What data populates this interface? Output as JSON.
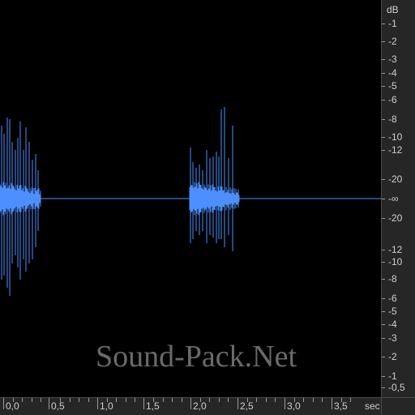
{
  "watermark": "Sound-Pack.Net",
  "db_ruler": {
    "unit": "dB",
    "upper": [
      "-1",
      "-2",
      "-3",
      "-4",
      "-5",
      "-6",
      "-8",
      "-10",
      "-12",
      "-20"
    ],
    "center": "-∞",
    "lower": [
      "-20",
      "-12",
      "-10",
      "-8",
      "-6",
      "-5",
      "-4",
      "-3",
      "-2",
      "-1",
      "-0,5"
    ]
  },
  "time_ruler": {
    "labels": [
      "0,0",
      "0,5",
      "1,0",
      "1,5",
      "2,0",
      "2,5",
      "3,0",
      "3,5"
    ],
    "unit": "sec"
  },
  "colors": {
    "waveform": "#4d8fff",
    "background": "#000000",
    "ruler_bg": "#262626",
    "ruler_text": "#cfcfcf"
  }
}
